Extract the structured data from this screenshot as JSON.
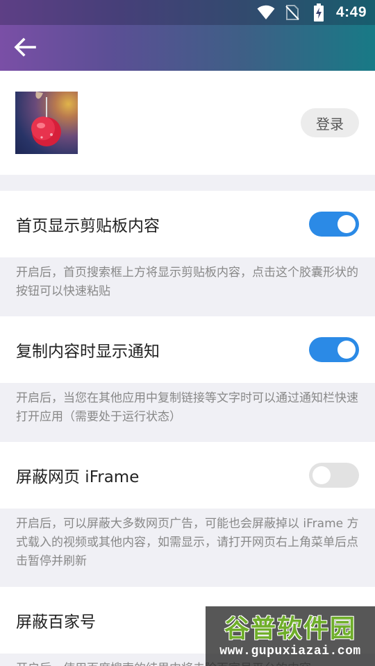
{
  "status_bar": {
    "time": "4:49",
    "icons": [
      "wifi-icon",
      "no-sim-icon",
      "battery-charging-icon"
    ]
  },
  "header": {
    "back_icon": "arrow-left-icon",
    "gradient_colors": [
      "#7a4fa6",
      "#187a86"
    ]
  },
  "profile": {
    "avatar_icon": "cherry-photo-avatar",
    "login_label": "登录"
  },
  "settings": [
    {
      "title": "首页显示剪贴板内容",
      "enabled": true,
      "description": "开启后，首页搜索框上方将显示剪贴板内容，点击这个胶囊形状的按钮可以快速粘贴"
    },
    {
      "title": "复制内容时显示通知",
      "enabled": true,
      "description": "开启后，当您在其他应用中复制链接等文字时可以通过通知栏快速打开应用（需要处于运行状态）"
    },
    {
      "title": "屏蔽网页 iFrame",
      "enabled": false,
      "description": "开启后，可以屏蔽大多数网页广告，可能也会屏蔽掉以 iFrame 方式载入的视频或其他内容，如需显示，请打开网页右上角菜单后点击暂停并刷新"
    },
    {
      "title": "屏蔽百家号",
      "description": "开启后，使用百度搜索的结果中将去除百家号平台的内容"
    }
  ],
  "colors": {
    "toggle_on": "#2b8ae6",
    "toggle_off": "#e2e2e2",
    "section_bg": "#f0f0f5"
  },
  "watermark": {
    "brand": "谷普软件园",
    "url": "www.gupuxiazai.com"
  }
}
